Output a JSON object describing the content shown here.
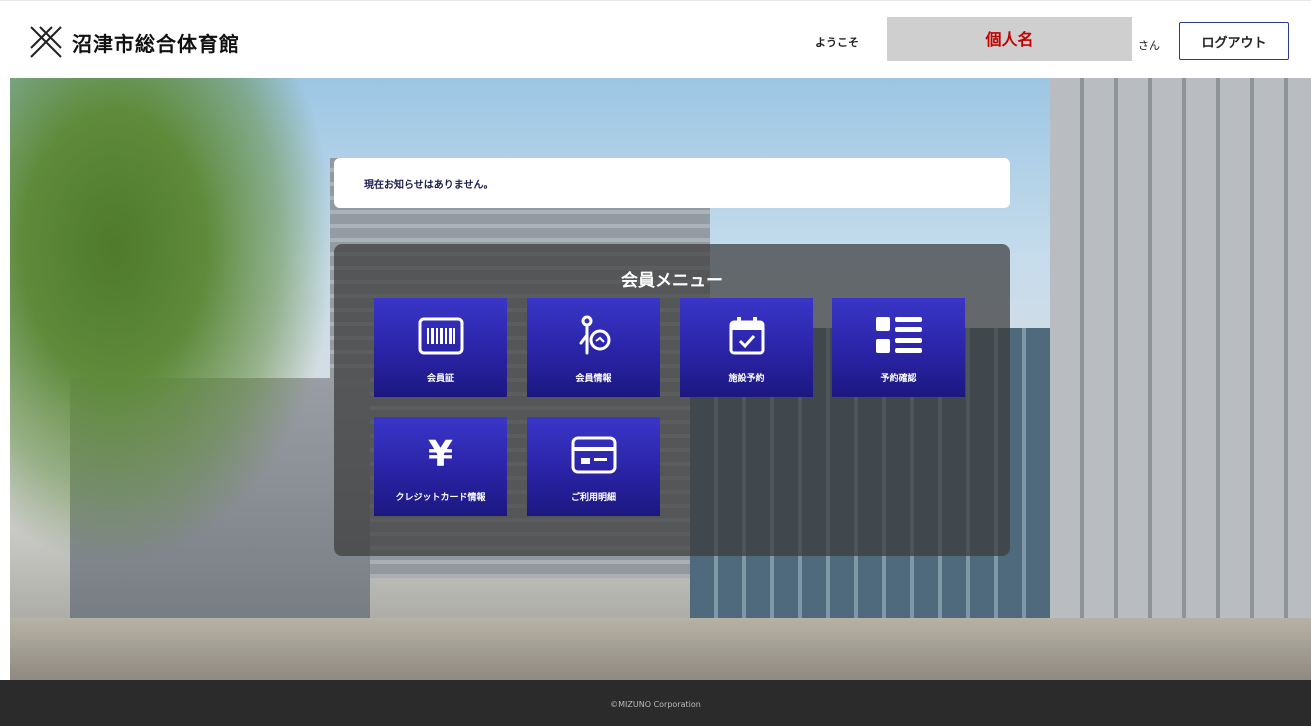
{
  "header": {
    "site_name": "沼津市総合体育館",
    "welcome_label": "ようこそ",
    "user_name": "個人名",
    "honorific": "さん",
    "logout_label": "ログアウト"
  },
  "notice": {
    "text": "現在お知らせはありません。"
  },
  "menu": {
    "title": "会員メニュー",
    "items": [
      {
        "label": "会員証",
        "icon": "barcode-card-icon"
      },
      {
        "label": "会員情報",
        "icon": "person-info-icon"
      },
      {
        "label": "施設予約",
        "icon": "calendar-check-icon"
      },
      {
        "label": "予約確認",
        "icon": "list-icon"
      },
      {
        "label": "クレジットカード情報",
        "icon": "yen-icon"
      },
      {
        "label": "ご利用明細",
        "icon": "receipt-card-icon"
      }
    ]
  },
  "footer": {
    "copyright": "©MIZUNO Corporation"
  },
  "colors": {
    "tile_top": "#3a36c8",
    "tile_bottom": "#1c1880",
    "username_text": "#c40000",
    "footer_bg": "#2b2b2b"
  }
}
